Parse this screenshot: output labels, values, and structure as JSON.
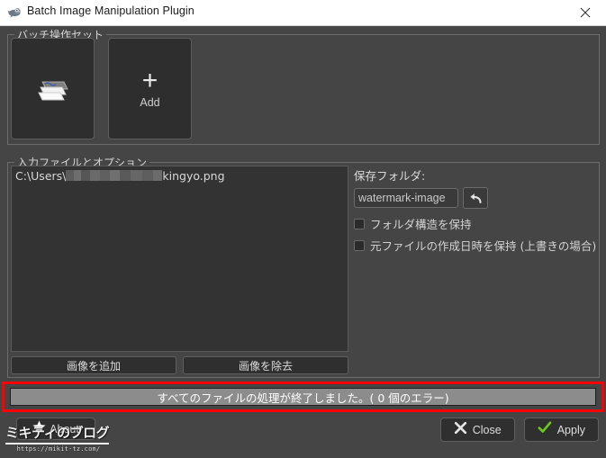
{
  "window": {
    "title": "Batch Image Manipulation Plugin",
    "icon": "gimp-wilber-icon",
    "close_icon": "close-icon"
  },
  "batch_group": {
    "legend": "バッチ操作セット",
    "tiles": [
      {
        "icon": "layer-stack-icon",
        "label": ""
      },
      {
        "icon": "plus-icon",
        "label": "Add"
      }
    ]
  },
  "input_group": {
    "legend": "入力ファイルとオプション",
    "files": [
      {
        "prefix": "C:\\Users\\",
        "redacted": true,
        "name": "kingyo.png"
      }
    ],
    "add_image_label": "画像を追加",
    "remove_image_label": "画像を除去"
  },
  "options": {
    "save_folder_label": "保存フォルダ:",
    "save_folder_value": "watermark-image",
    "save_folder_placeholder": "watermark-image",
    "undo_icon": "undo-arrow-icon",
    "checkboxes": [
      {
        "label": "フォルダ構造を保持",
        "checked": false
      },
      {
        "label": "元ファイルの作成日時を保持 (上書きの場合)",
        "checked": false
      }
    ]
  },
  "progress": {
    "status_text": "すべてのファイルの処理が終了しました。( 0 個のエラー)",
    "percent": 100,
    "highlight_color": "#ff0000",
    "fill_color": "#8c8c8c"
  },
  "footer": {
    "about_label": "About",
    "about_icon": "star-icon",
    "close_label": "Close",
    "close_icon": "x-icon",
    "apply_label": "Apply",
    "apply_icon": "check-icon",
    "apply_icon_color": "#6ec81e"
  },
  "watermark": {
    "title": "ミキティのブログ",
    "url": "https://mikit-tz.com/"
  }
}
